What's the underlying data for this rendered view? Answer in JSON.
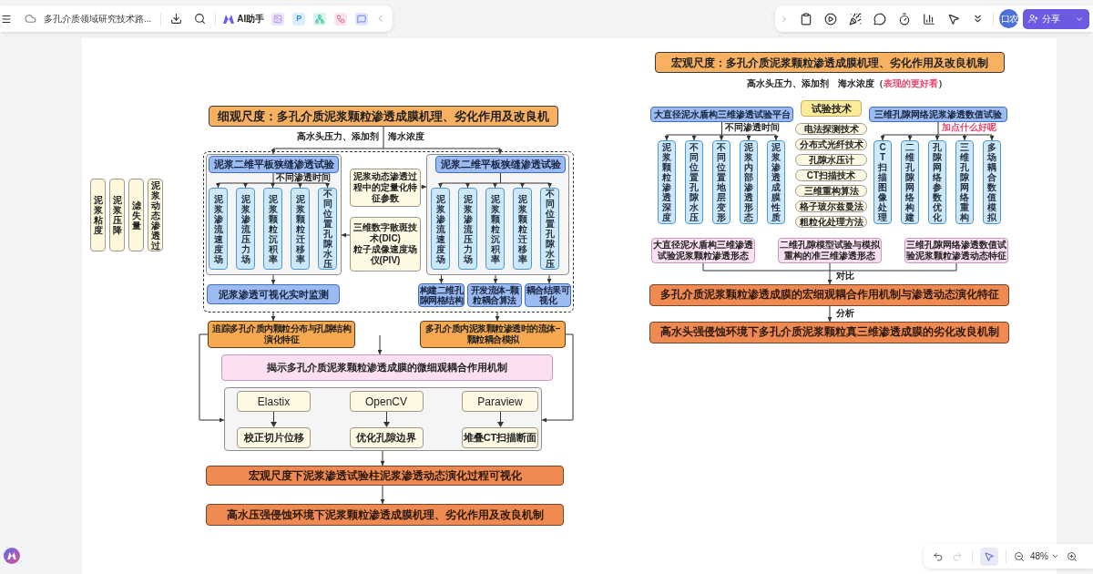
{
  "header": {
    "title": "多孔介质领域研究技术路...",
    "ai_label": "AI助手",
    "app_icons": [
      {
        "kind": "image"
      },
      {
        "kind": "letter",
        "label": "P"
      },
      {
        "kind": "mindmap"
      },
      {
        "kind": "flow"
      },
      {
        "kind": "chat"
      }
    ],
    "avatar_text": "口农",
    "share_label": "分享"
  },
  "micro": {
    "title": "细观尺度：多孔介质泥浆颗粒渗透成膜机理、劣化作用及改良机",
    "conditions": "高水头压力、添加剂",
    "concentration": "海水浓度",
    "side_labels": [
      "泥浆粘度",
      "泥浆压降",
      "滤失量",
      "泥浆动态渗透过"
    ],
    "experiments": [
      {
        "header": "泥浆二维平板狭缝渗透试验",
        "branch_label": {
          "text": "不同渗透时间",
          "kind": "caption"
        },
        "columns": [
          "泥浆渗流速度场",
          "泥浆渗流压力场",
          "泥浆颗粒沉积率",
          "泥浆颗粒迁移率",
          "不同位置孔隙水压"
        ],
        "results": [
          "泥浆渗透可视化实时监测"
        ]
      },
      {
        "header": "泥浆二维平板狭缝渗透试验",
        "columns": [
          "泥浆渗流速度场",
          "泥浆渗流压力场",
          "泥浆颗粒沉积率",
          "泥浆颗粒迁移率",
          "不同位置孔隙水压"
        ],
        "results": [
          "构建二维孔隙网格结构",
          "开发流体–颗粒耦合算法",
          "耦合结果可视化"
        ]
      }
    ],
    "notes": [
      {
        "lines": [
          "泥浆动态渗透过程中的定量化特征参数"
        ]
      },
      {
        "lines": [
          "三维数字散斑技术(DIC)",
          "粒子成像速度场仪(PIV)"
        ]
      }
    ],
    "findings": [
      "追踪多孔介质内颗粒分布与孔隙结构演化特征",
      "多孔介质内泥浆颗粒渗透时的流体–颗粒耦合模拟"
    ],
    "mechanism": "揭示多孔介质泥浆颗粒渗透成膜的微细观耦合作用机制",
    "tools": [
      {
        "name": "Elastix",
        "result": "校正切片位移"
      },
      {
        "name": "OpenCV",
        "result": "优化孔隙边界"
      },
      {
        "name": "Paraview",
        "result": "堆叠CT扫描断面"
      }
    ],
    "conclusions": [
      "宏观尺度下泥浆渗透试验柱泥浆渗透动态演化过程可视化",
      "高水压强侵蚀环境下泥浆颗粒渗透成膜机理、劣化作用及改良机制"
    ]
  },
  "macro": {
    "title": "宏观尺度：多孔介质泥浆颗粒渗透成膜机理、劣化作用及改良机制",
    "conditions": "高水头压力、添加剂",
    "parameters_line": {
      "before": "海水浓度（",
      "highlight": "表现的更好看",
      "after": "）"
    },
    "platforms": [
      {
        "header": "大直径泥水盾构三维渗透试验平台",
        "branch_label": {
          "text": "不同渗透时间",
          "kind": "caption"
        },
        "columns": [
          "泥浆颗粒渗透深度",
          "不同位置孔隙水压",
          "不同位置地层变形",
          "泥浆内部渗透形态",
          "泥浆渗透成膜性质"
        ]
      },
      {
        "header": "三维孔隙网络泥浆渗透数值试验",
        "branch_label": {
          "text": "加点什么好呢",
          "kind": "comment"
        },
        "columns": [
          "CT扫描图像处理",
          "二维孔隙网络构建",
          "孔隙网络参数优化",
          "三维孔隙网络重构",
          "多场耦合数值模拟"
        ]
      }
    ],
    "techniques": {
      "header": "试验技术",
      "items": [
        "电法探测技术",
        "分布式光纤技术",
        "孔隙水压计",
        "CT扫描技术",
        "三维重构算法",
        "格子玻尔兹曼法",
        "粗粒化处理方法"
      ]
    },
    "outcomes": [
      "大直径泥水盾构三维渗透试验泥浆颗粒渗透形态",
      "二维孔隙模型试验与模拟重构的准三维渗透形态",
      "三维孔隙网络渗透数值试验泥浆颗粒渗透动态特征"
    ],
    "compare_label": "对比",
    "synthesis": "多孔介质泥浆颗粒渗透成膜的宏细观耦合作用机制与渗透动态演化特征",
    "analysis_label": "分析",
    "conclusion": "高水头强侵蚀环境下多孔介质泥浆颗粒真三维渗透成膜的劣化改良机制"
  },
  "footer": {
    "undo_disabled": false,
    "redo_disabled": true,
    "pointer_selected": true,
    "zoom": "48%"
  }
}
